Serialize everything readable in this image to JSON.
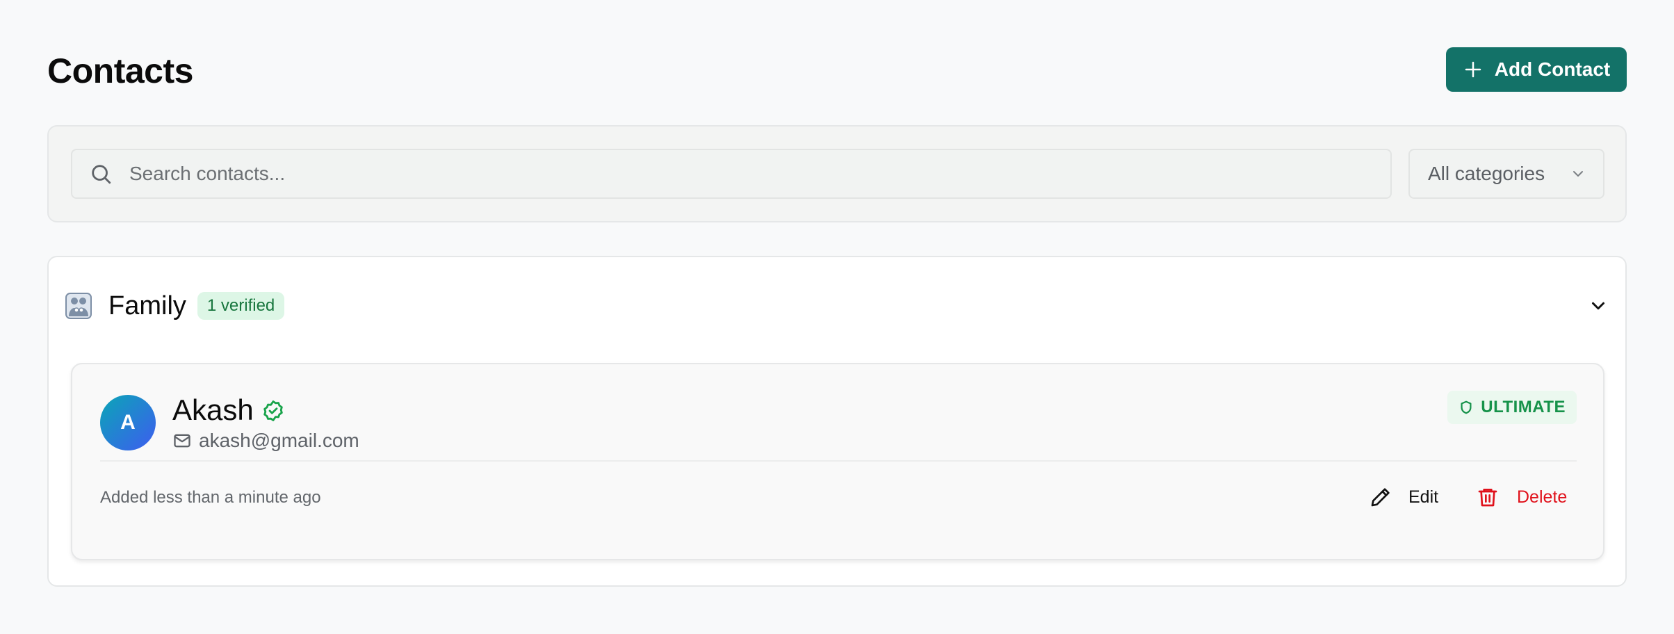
{
  "header": {
    "title": "Contacts",
    "add_button_label": "Add Contact",
    "add_button_icon": "plus-icon"
  },
  "filters": {
    "search_placeholder": "Search contacts...",
    "search_value": "",
    "search_icon": "search-icon",
    "category_selected": "All categories",
    "category_icon": "chevron-down-icon"
  },
  "groups": [
    {
      "name": "Family",
      "icon": "family-icon",
      "badge": "1 verified",
      "expanded": true,
      "contacts": [
        {
          "initial": "A",
          "name": "Akash",
          "email": "akash@gmail.com",
          "verified": true,
          "tier": "ULTIMATE",
          "added": "Added less than a minute ago",
          "edit_label": "Edit",
          "delete_label": "Delete"
        }
      ]
    }
  ],
  "colors": {
    "accent": "#137268",
    "verified_badge_bg": "#ddf6e6",
    "verified_badge_text": "#18763e",
    "tier_text": "#16924a",
    "delete": "#e0111b",
    "avatar_gradient_start": "#0aa6b6",
    "avatar_gradient_end": "#3e5cf0"
  }
}
